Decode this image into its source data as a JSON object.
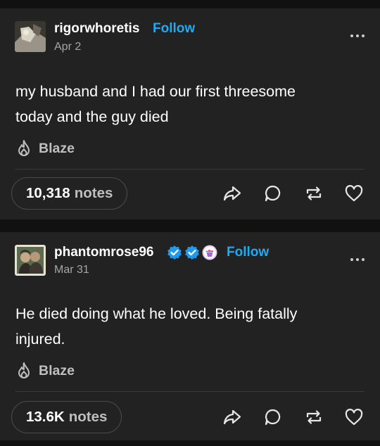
{
  "posts": [
    {
      "username": "rigorwhoretis",
      "follow_label": "Follow",
      "date": "Apr 2",
      "body_lines": [
        "my husband and I had our first threesome",
        "today and the guy died"
      ],
      "blaze_label": "Blaze",
      "notes_count": "10,318",
      "notes_word": "notes",
      "icons": [
        "share-icon",
        "reply-icon",
        "reblog-icon",
        "like-icon"
      ]
    },
    {
      "username": "phantomrose96",
      "follow_label": "Follow",
      "date": "Mar 31",
      "body_lines": [
        "He died doing what he loved. Being fatally",
        "injured."
      ],
      "blaze_label": "Blaze",
      "notes_count": "13.6K",
      "notes_word": "notes",
      "badges": [
        "verified-badge-icon",
        "verified-badge-icon",
        "cupcake-badge-icon"
      ],
      "icons": [
        "share-icon",
        "reply-icon",
        "reblog-icon",
        "like-icon"
      ]
    }
  ],
  "colors": {
    "background": "#111111",
    "card": "#222222",
    "accent": "#20aaf0",
    "muted": "#a6a6a6"
  }
}
